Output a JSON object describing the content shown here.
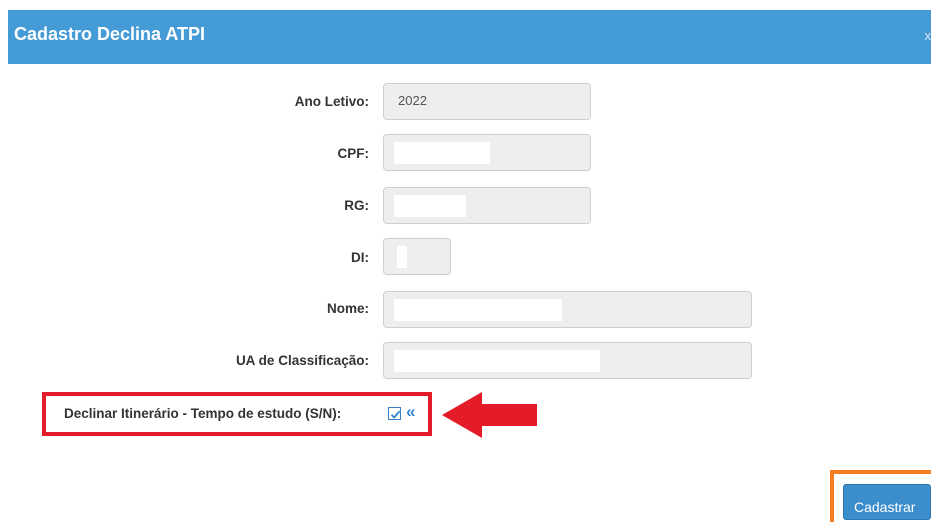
{
  "modal": {
    "title": "Cadastro Declina ATPI",
    "close_glyph": "x"
  },
  "form": {
    "ano_letivo": {
      "label": "Ano Letivo:",
      "value": "2022"
    },
    "cpf": {
      "label": "CPF:",
      "value": ""
    },
    "rg": {
      "label": "RG:",
      "value": ""
    },
    "di": {
      "label": "DI:",
      "value": ""
    },
    "nome": {
      "label": "Nome:",
      "value": ""
    },
    "ua": {
      "label": "UA de Classificação:",
      "value": ""
    },
    "declinar": {
      "label": "Declinar Itinerário - Tempo de estudo (S/N):",
      "checked": true,
      "chevron": "«"
    }
  },
  "actions": {
    "submit_label": "Cadastrar"
  },
  "colors": {
    "header": "#459bd6",
    "highlight_red": "#e41c2a",
    "highlight_orange": "#f57c1f",
    "button": "#3c8dcb"
  },
  "icons": {
    "checkbox": "checkmark-icon",
    "expand": "double-chevron-left-icon",
    "annotation": "red-arrow-icon"
  }
}
